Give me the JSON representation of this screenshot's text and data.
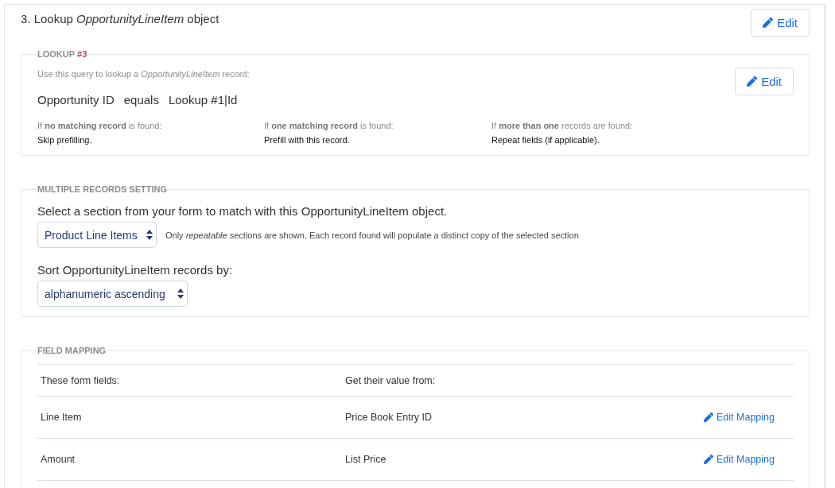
{
  "section": {
    "title": "3. Lookup *OpportunityLineItem* object",
    "edit_button": {
      "label": "Edit"
    }
  },
  "lookup": {
    "legend": "LOOKUP",
    "number": "#3",
    "description": "Use this query to lookup a *OpportunityLineItem* record:",
    "condition": {
      "field": "Opportunity ID",
      "operator": "equals",
      "value": "Lookup #1|Id"
    },
    "edit_button": {
      "label": "Edit"
    },
    "outcomes": [
      {
        "case": "If **no matching record** is found:",
        "action": "Skip prefilling."
      },
      {
        "case": "If **one matching record** is found:",
        "action": "Prefill with this record."
      },
      {
        "case": "If **more than one** records are found:",
        "action": "Repeat fields (if applicable)."
      }
    ]
  },
  "multiple_records": {
    "legend": "MULTIPLE RECORDS SETTING",
    "section_prompt": "Select a section from your form to match with this OpportunityLineItem object.",
    "section_select": {
      "value": "Product Line Items"
    },
    "section_hint": "Only *repeatable* sections are shown. Each record found will populate a distinct copy of the selected section",
    "sort_prompt": "Sort OpportunityLineItem records by:",
    "sort_select": {
      "value": "alphanumeric ascending"
    }
  },
  "field_mapping": {
    "legend": "FIELD MAPPING",
    "columns": [
      "These form fields:",
      "Get their value from:"
    ],
    "rows": [
      {
        "form_field": "Line Item",
        "source": "Price Book Entry ID",
        "action": "Edit Mapping"
      },
      {
        "form_field": "Amount",
        "source": "List Price",
        "action": "Edit Mapping"
      }
    ]
  }
}
